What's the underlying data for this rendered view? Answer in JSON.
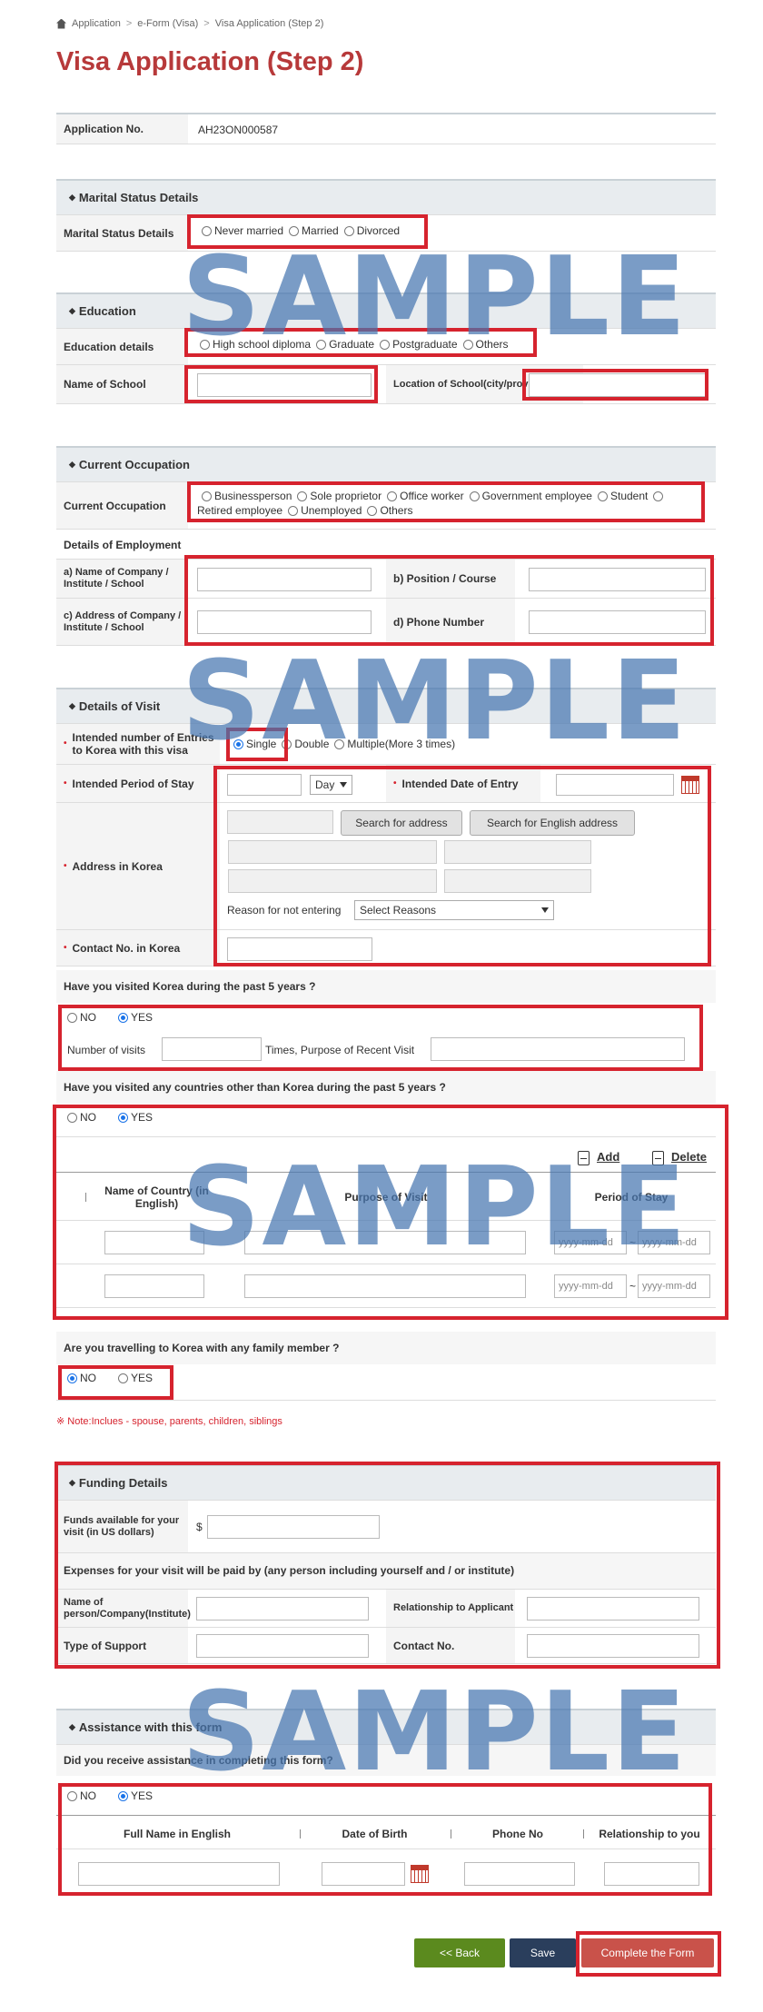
{
  "breadcrumb": {
    "items": [
      "Application",
      "e-Form (Visa)",
      "Visa Application (Step 2)"
    ],
    "sep": ">"
  },
  "page_title": "Visa Application (Step 2)",
  "application": {
    "label": "Application No.",
    "value": "AH23ON000587"
  },
  "marital": {
    "section": "Marital Status Details",
    "label": "Marital Status Details",
    "options": [
      "Never married",
      "Married",
      "Divorced"
    ]
  },
  "education": {
    "section": "Education",
    "label": "Education details",
    "options": [
      "High school diploma",
      "Graduate",
      "Postgraduate",
      "Others"
    ],
    "school_label": "Name of School",
    "location_label": "Location of School(city/province/cou"
  },
  "occupation": {
    "section": "Current Occupation",
    "label": "Current Occupation",
    "options_line1": [
      "Businessperson",
      "Sole proprietor",
      "Office worker",
      "Government employee",
      "Student",
      ""
    ],
    "options_line2": [
      "Retired employee",
      "Unemployed",
      "Others"
    ],
    "employment_title": "Details of Employment",
    "company_label": "a) Name of Company / Institute / School",
    "position_label": "b) Position / Course",
    "address_label": "c) Address of Company / Institute / School",
    "phone_label": "d) Phone Number"
  },
  "visit": {
    "section": "Details of Visit",
    "entries_label": "Intended number of Entries to Korea with this visa",
    "entries_options": [
      "Single",
      "Double",
      "Multiple(More 3 times)"
    ],
    "period_label": "Intended Period of Stay",
    "period_unit": "Day",
    "entry_date_label": "Intended Date of Entry",
    "address_label": "Address in Korea",
    "search_address": "Search for address",
    "search_english": "Search for English address",
    "reason_label": "Reason for not entering",
    "reason_select": "Select Reasons",
    "contact_label": "Contact No. in Korea"
  },
  "korea_visits": {
    "question": "Have you visited Korea during the past 5 years ?",
    "no": "NO",
    "yes": "YES",
    "visits_label": "Number of visits",
    "purpose_label": "Times, Purpose of Recent Visit"
  },
  "other_countries": {
    "question": "Have you visited any countries other than Korea during the past 5 years ?",
    "no": "NO",
    "yes": "YES",
    "add": "Add",
    "delete": "Delete",
    "col_country": "Name of Country (in English)",
    "col_purpose": "Purpose of Visit",
    "col_period": "Period of Stay",
    "date_placeholder": "yyyy-mm-dd",
    "tilde": "~"
  },
  "family": {
    "question": "Are you travelling to Korea with any family member ?",
    "no": "NO",
    "yes": "YES",
    "note": "※ Note:Inclues - spouse, parents, children, siblings"
  },
  "funding": {
    "section": "Funding Details",
    "funds_label": "Funds available for your visit (in US dollars)",
    "currency": "$",
    "expenses_label": "Expenses for your visit will be paid by (any person including yourself and / or institute)",
    "name_label": "Name of person/Company(Institute)",
    "relationship_label": "Relationship to Applicant",
    "support_label": "Type of Support",
    "contact_label": "Contact No."
  },
  "assistance": {
    "section": "Assistance with this form",
    "question": "Did you receive assistance in completing this form?",
    "no": "NO",
    "yes": "YES",
    "col_name": "Full Name in English",
    "col_dob": "Date of Birth",
    "col_phone": "Phone No",
    "col_rel": "Relationship to you"
  },
  "actions": {
    "back": "<<   Back",
    "save": "Save",
    "complete": "Complete the Form"
  },
  "watermark": "SAMPLE",
  "colors": {
    "title": "#b7393a",
    "highlight": "#d6232e",
    "back": "#5b8a1e",
    "save": "#2a3e5c",
    "complete": "#c9524a"
  }
}
